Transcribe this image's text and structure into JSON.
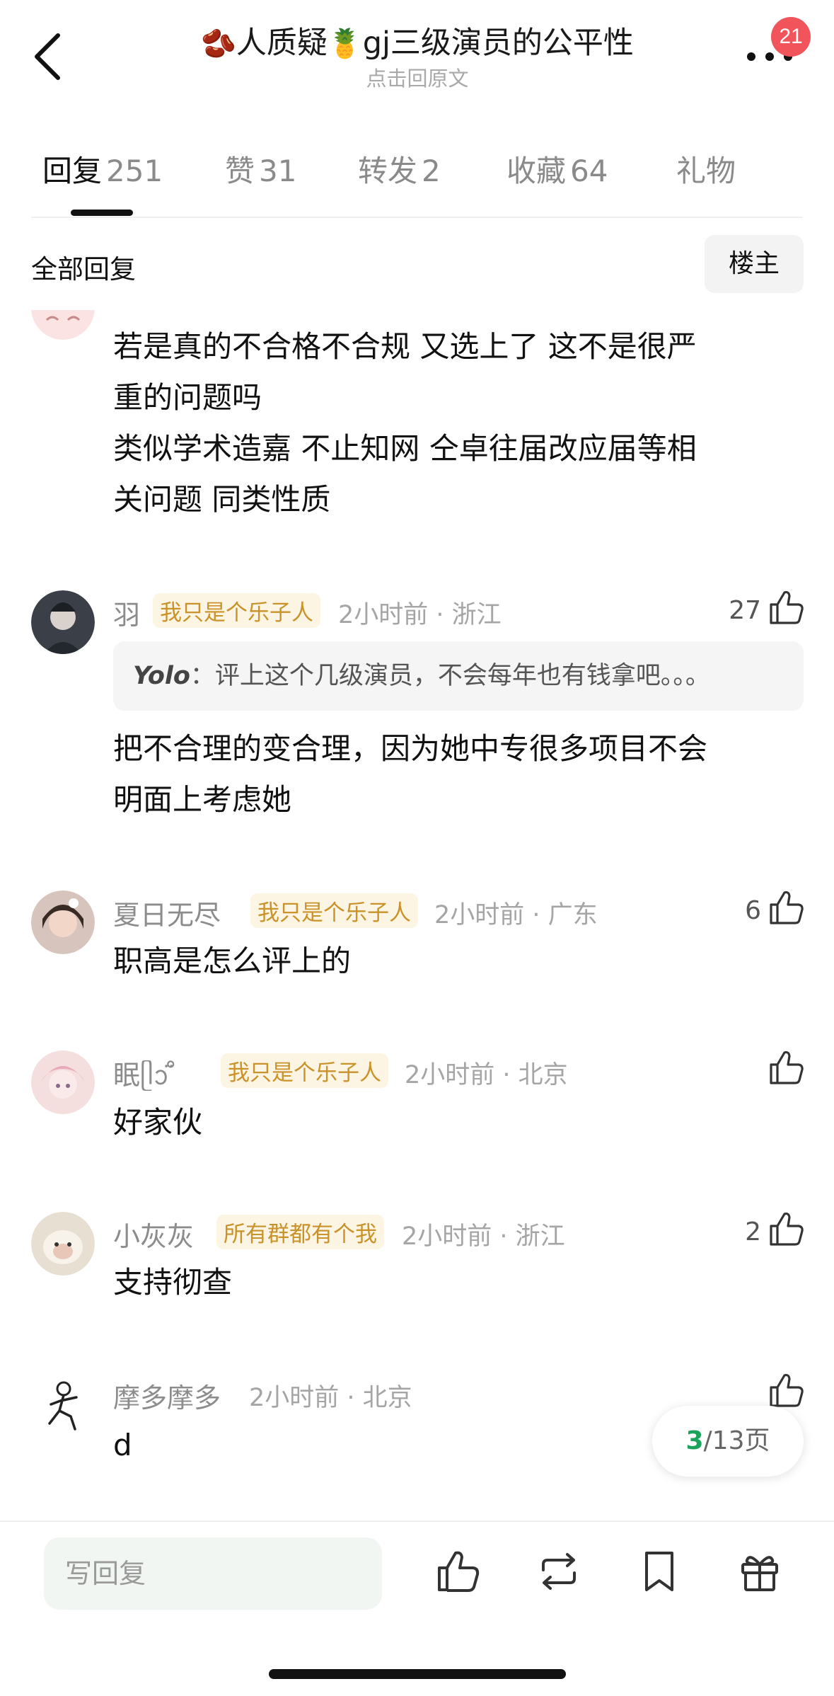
{
  "header": {
    "title_prefix_emoji": "🫘",
    "title_part1": "人质疑",
    "title_mid_emoji": "🍍",
    "title_part2": "gj三级演员的公平性",
    "subtitle": "点击回原文",
    "badge_count": "21"
  },
  "tabs": [
    {
      "label": "回复",
      "count": "251",
      "active": true
    },
    {
      "label": "赞",
      "count": "31"
    },
    {
      "label": "转发",
      "count": "2"
    },
    {
      "label": "收藏",
      "count": "64"
    },
    {
      "label": "礼物",
      "count": ""
    }
  ],
  "section": {
    "title": "全部回复",
    "owner_button": "楼主"
  },
  "comments": [
    {
      "text_lines": [
        "若是真的不合格不合规 又选上了 这不是很严",
        "重的问题吗",
        "类似学术造嘉 不止知网 仝卓往届改应届等相",
        "关问题 同类性质"
      ]
    },
    {
      "name": "羽",
      "tag": "我只是个乐子人",
      "meta": "2小时前 · 浙江",
      "likes": "27",
      "quote_name": "Yolo",
      "quote_text": "：评上这个几级演员，不会每年也有钱拿吧。。。",
      "text_lines": [
        "把不合理的变合理，因为她中专很多项目不会",
        "明面上考虑她"
      ]
    },
    {
      "name": "夏日无尽",
      "tag": "我只是个乐子人",
      "meta": "2小时前 · 广东",
      "likes": "6",
      "text_lines": [
        "职高是怎么评上的"
      ]
    },
    {
      "name": "眠ᥫᩣ̈ ̊",
      "tag": "我只是个乐子人",
      "meta": "2小时前 · 北京",
      "likes": "",
      "text_lines": [
        "好家伙"
      ]
    },
    {
      "name": "小灰灰",
      "tag": "所有群都有个我",
      "meta": "2小时前 · 浙江",
      "likes": "2",
      "text_lines": [
        "支持彻查"
      ]
    },
    {
      "name": "摩多摩多",
      "meta": "2小时前 · 北京",
      "likes": "",
      "text_lines": [
        "d"
      ]
    }
  ],
  "pagination": {
    "current": "3",
    "total_text": "/13页"
  },
  "bottom_bar": {
    "reply_placeholder": "写回复"
  },
  "colors": {
    "accent_green": "#1aa35a",
    "badge_red": "#f2545b",
    "tag_gold": "#c9922a"
  }
}
